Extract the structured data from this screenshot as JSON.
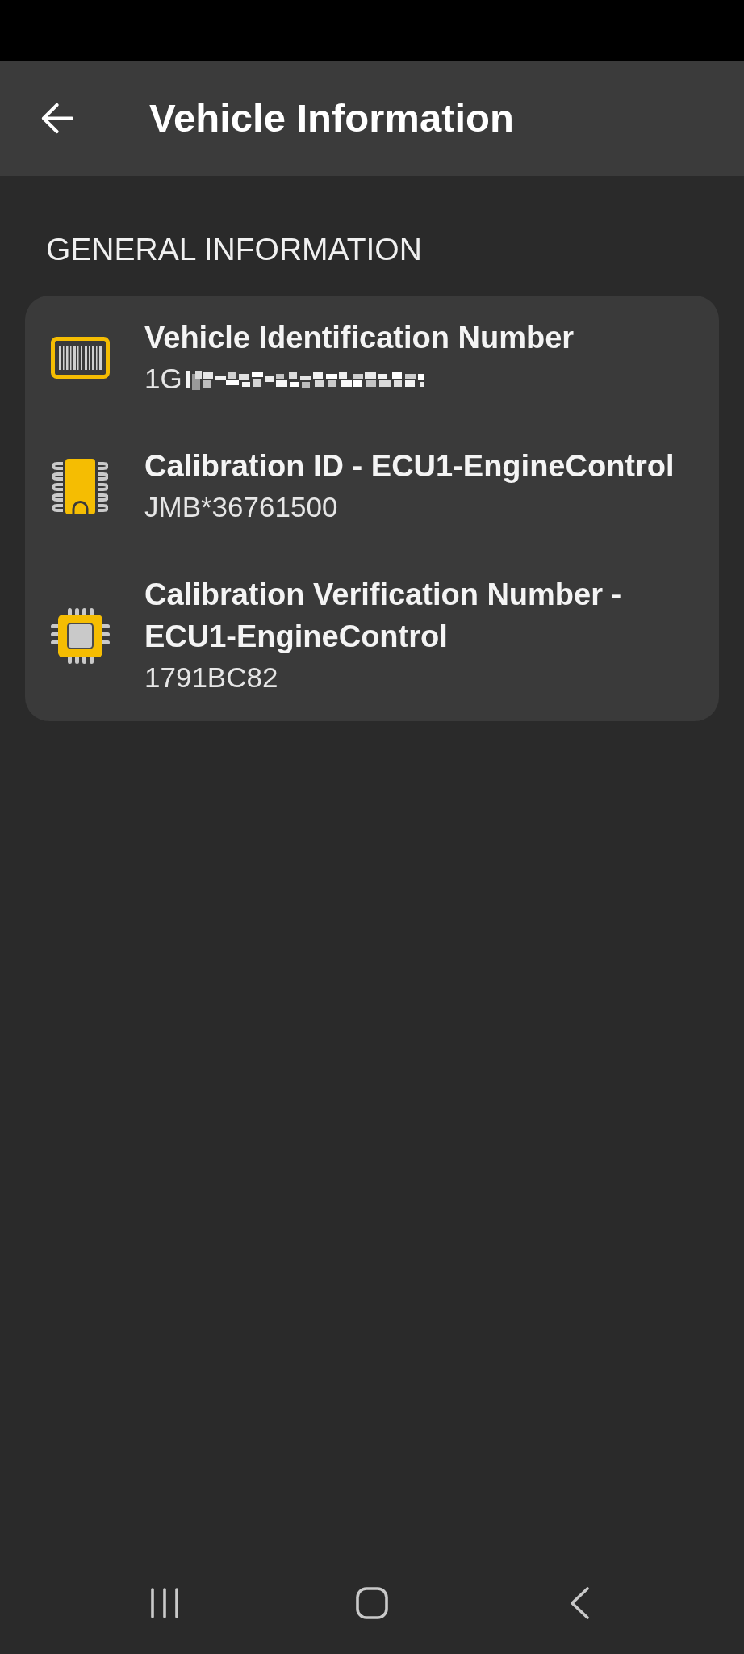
{
  "app_bar": {
    "title": "Vehicle Information"
  },
  "section": {
    "heading": "GENERAL INFORMATION",
    "items": [
      {
        "kind": "vin",
        "title": "Vehicle Identification Number",
        "value": "1G",
        "redacted": true
      },
      {
        "kind": "calid",
        "title": "Calibration ID - ECU1-EngineControl",
        "value": "JMB*36761500",
        "redacted": false
      },
      {
        "kind": "cvn",
        "title": "Calibration Verification Number - ECU1-EngineControl",
        "value": "1791BC82",
        "redacted": false
      }
    ]
  }
}
